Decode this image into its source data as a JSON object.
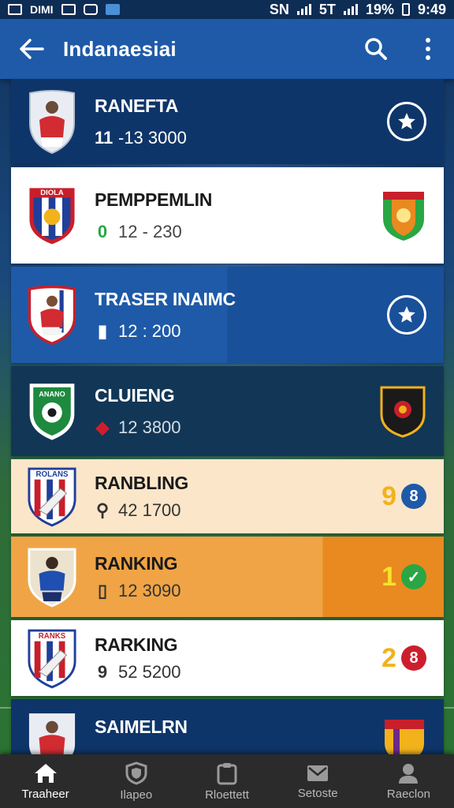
{
  "status_bar": {
    "left_label": "DIMI",
    "carrier": "SN",
    "signal_text": "5T",
    "battery": "19%",
    "time": "9:49"
  },
  "app_bar": {
    "title": "Indanaesiai"
  },
  "colors": {
    "app_bar": "#1e5aa8",
    "row_navy": "#0e3569",
    "row_white": "#ffffff",
    "row_blue": "#1e5aa8",
    "row_dark": "#123656",
    "row_cream": "#fbe6c9",
    "row_orange": "#f0a445",
    "accent_orange": "#e88a20",
    "gold": "#f2b21c",
    "red": "#cc1f2e",
    "green": "#2aa644",
    "nav_bg": "#2b2b2b"
  },
  "teams": [
    {
      "name": "RANEFTA",
      "meta_glyph": "11",
      "meta_value": "-13 3000",
      "right": "favorite-star",
      "crest_icon": "player-crest-icon"
    },
    {
      "name": "PEMPPEMLIN",
      "meta_glyph": "0",
      "meta_value": "12 - 230",
      "right": "club-badge",
      "crest_icon": "club-crest-icon"
    },
    {
      "name": "TRASER INAIMC",
      "meta_glyph": "▮",
      "meta_value": "12 : 200",
      "right": "favorite-star",
      "crest_icon": "player-crest-icon"
    },
    {
      "name": "CLUIENG",
      "meta_glyph": "◆",
      "meta_value": "12 3800",
      "right": "club-badge",
      "crest_icon": "club-crest-icon"
    },
    {
      "name": "RANBLING",
      "meta_glyph": "⚲",
      "meta_value": "42 1700",
      "right": "rank",
      "rank_number": "9",
      "rank_symbol": "8",
      "crest_icon": "player-crest-icon"
    },
    {
      "name": "RANKING",
      "meta_glyph": "▯",
      "meta_value": "12 3090",
      "right": "rank",
      "rank_number": "1",
      "rank_symbol": "✓",
      "crest_icon": "player-crest-icon"
    },
    {
      "name": "RARKING",
      "meta_glyph": "9",
      "meta_value": "52 5200",
      "right": "rank",
      "rank_number": "2",
      "rank_symbol": "8",
      "crest_icon": "player-crest-icon"
    },
    {
      "name": "SAIMELRN",
      "meta_glyph": "",
      "meta_value": "",
      "right": "club-badge",
      "crest_icon": "player-crest-icon"
    }
  ],
  "crest_labels": {
    "row1": "DIOLA",
    "row4": "ANANO",
    "row5": "ROLANS",
    "row7": "RANKS"
  },
  "bottom_nav": [
    {
      "label": "Traaheer",
      "icon": "home-icon"
    },
    {
      "label": "Ilapeo",
      "icon": "shield-icon"
    },
    {
      "label": "Rloettett",
      "icon": "clipboard-icon"
    },
    {
      "label": "Setoste",
      "icon": "mail-icon"
    },
    {
      "label": "Raeclon",
      "icon": "person-icon"
    }
  ]
}
